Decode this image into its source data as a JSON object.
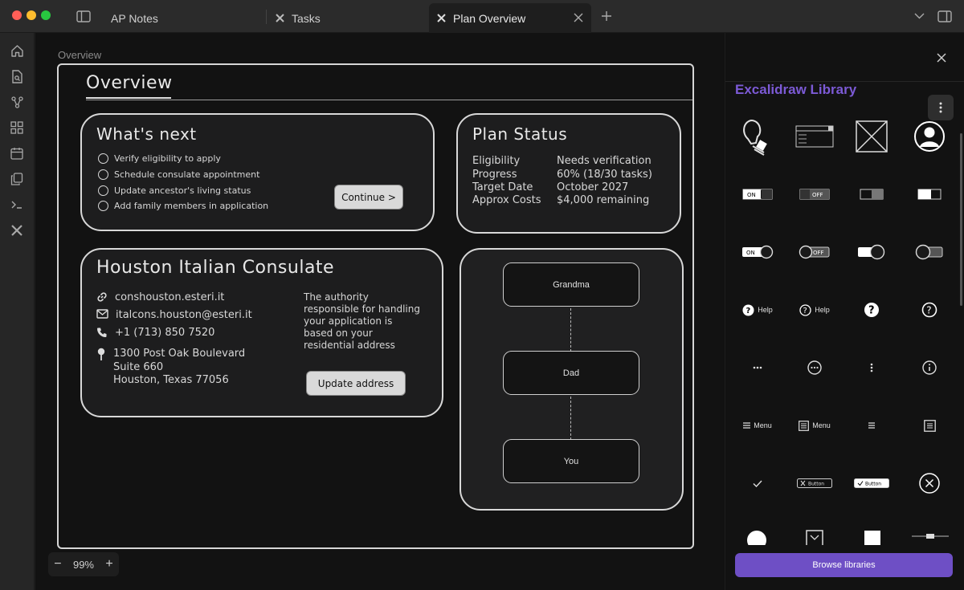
{
  "tabs": [
    {
      "label": "AP Notes"
    },
    {
      "label": "Tasks"
    },
    {
      "label": "Plan Overview"
    }
  ],
  "breadcrumb": "Overview",
  "frame_title": "Overview",
  "whats_next": {
    "title": "What's next",
    "items": [
      "Verify eligibility to apply",
      "Schedule consulate appointment",
      "Update ancestor's living status",
      "Add family members in application"
    ],
    "button": "Continue >"
  },
  "plan_status": {
    "title": "Plan Status",
    "rows": [
      {
        "label": "Eligibility",
        "value": "Needs verification"
      },
      {
        "label": "Progress",
        "value": "60% (18/30 tasks)"
      },
      {
        "label": "Target Date",
        "value": "October 2027"
      },
      {
        "label": "Approx Costs",
        "value": "$4,000 remaining"
      }
    ]
  },
  "consulate": {
    "title": "Houston Italian Consulate",
    "website": "conshouston.esteri.it",
    "email": "italcons.houston@esteri.it",
    "phone": "+1 (713) 850 7520",
    "address_line1": "1300 Post Oak Boulevard",
    "address_line2": "Suite 660",
    "address_line3": "Houston, Texas 77056",
    "note": "The authority responsible for handling your application is based on your residential address",
    "button": "Update address"
  },
  "family_tree": [
    "Grandma",
    "Dad",
    "You"
  ],
  "zoom": "99%",
  "library": {
    "title": "Excalidraw Library",
    "toggle_on": "ON",
    "toggle_off": "OFF",
    "help_label": "Help",
    "menu_label": "Menu",
    "button_label": "Button",
    "browse_button": "Browse libraries"
  },
  "colors": {
    "accent": "#6e4fc5",
    "library_title": "#7c5ad6",
    "canvas_bg": "#121212",
    "card_bg": "#1d1d1e"
  }
}
